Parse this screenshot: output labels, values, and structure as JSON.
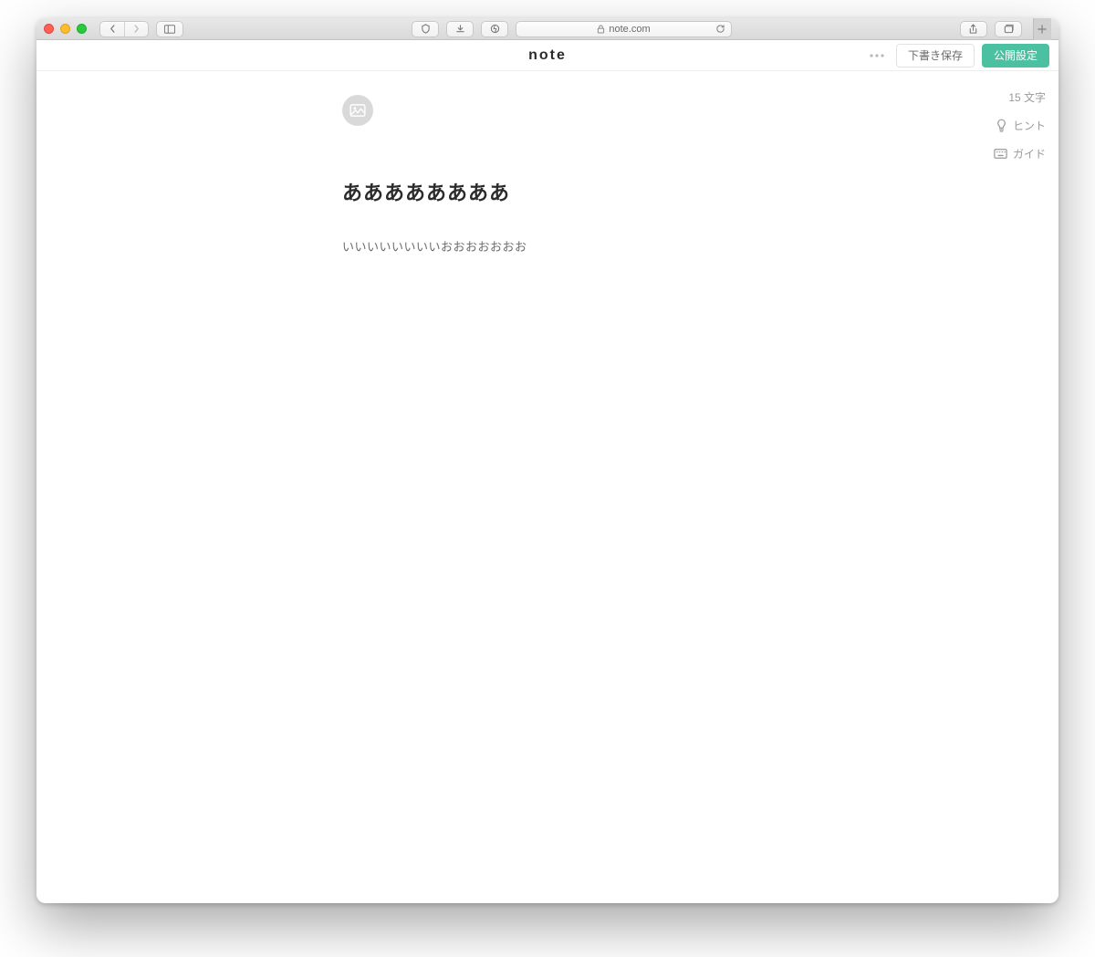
{
  "browser": {
    "url_host": "note.com"
  },
  "header": {
    "brand": "note",
    "draft_save_label": "下書き保存",
    "publish_label": "公開設定"
  },
  "side": {
    "char_count": "15 文字",
    "hint_label": "ヒント",
    "guide_label": "ガイド"
  },
  "editor": {
    "title": "ああああああああ",
    "body": "いいいいいいいいおおおおおおお"
  }
}
